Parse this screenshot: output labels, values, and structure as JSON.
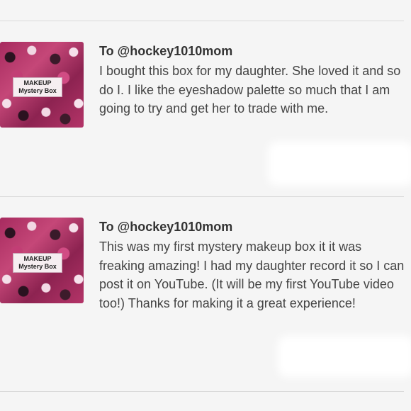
{
  "comments": [
    {
      "thumbnail": {
        "line1": "MAKEUP",
        "line2": "Mystery Box"
      },
      "mention": "To @hockey1010mom",
      "text": "I bought this box for my daughter. She loved it and so do I. I like the eyeshadow palette so much that I am going to try and get her to trade with me."
    },
    {
      "thumbnail": {
        "line1": "MAKEUP",
        "line2": "Mystery Box"
      },
      "mention": "To @hockey1010mom",
      "text": "This was my first mystery makeup box it it was freaking amazing! I had my daughter record it so I can post it on YouTube. (It will be my first YouTube video too!) Thanks for making it a great experience!"
    }
  ],
  "colors": {
    "background": "#f5f5f5",
    "divider": "#d9d9d9",
    "mention_text": "#333333",
    "body_text": "#444444",
    "thumbnail_accent": "#c54778"
  }
}
